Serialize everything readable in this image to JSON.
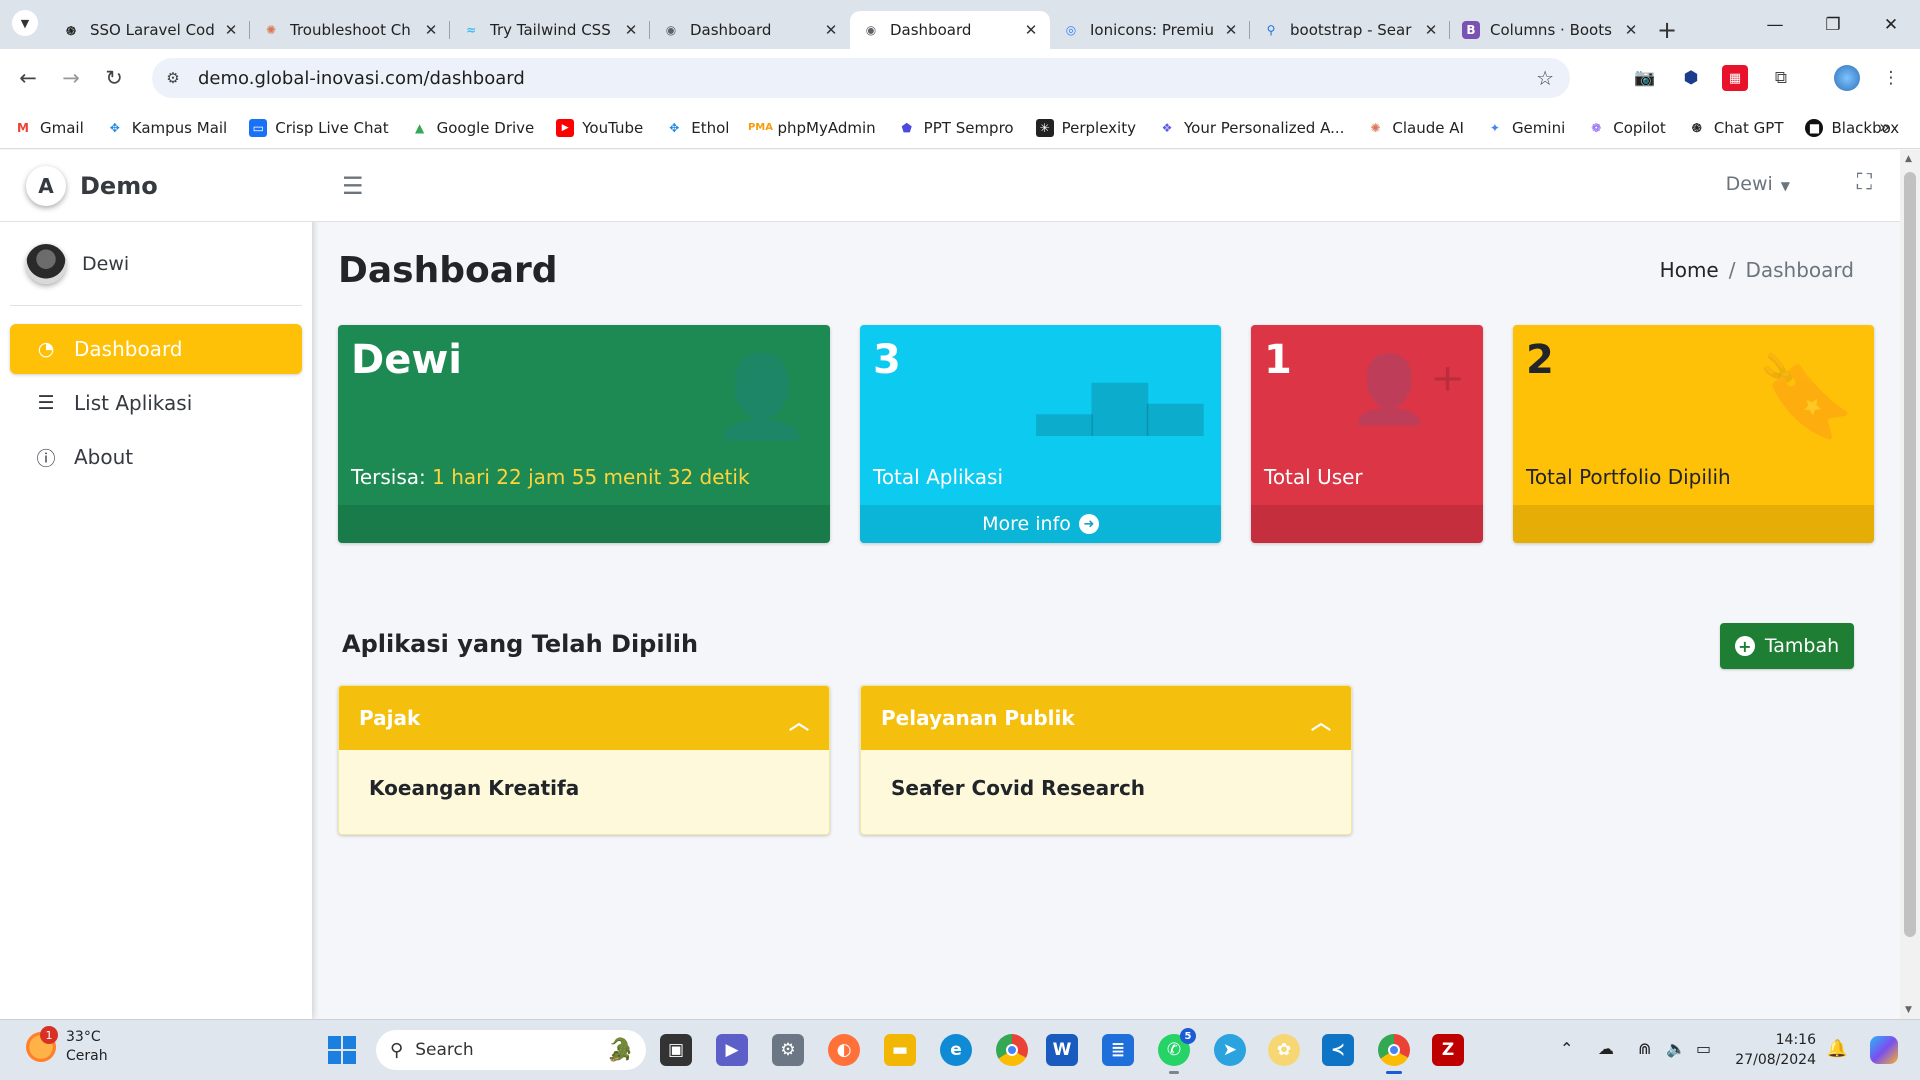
{
  "browser": {
    "tabs": [
      {
        "title": "SSO Laravel Cod",
        "icon": "openai-icon",
        "color": "#222222",
        "active": false
      },
      {
        "title": "Troubleshoot Ch",
        "icon": "claude-icon",
        "color": "#d97757",
        "active": false
      },
      {
        "title": "Try Tailwind CSS",
        "icon": "tailwind-icon",
        "color": "#38bdf8",
        "active": false
      },
      {
        "title": "Dashboard",
        "icon": "globe-icon",
        "color": "#5f6368",
        "active": false
      },
      {
        "title": "Dashboard",
        "icon": "globe-icon",
        "color": "#5f6368",
        "active": true
      },
      {
        "title": "Ionicons: Premiu",
        "icon": "ionicons-icon",
        "color": "#3880ff",
        "active": false
      },
      {
        "title": "bootstrap - Sear",
        "icon": "search-icon",
        "color": "#1a73e8",
        "active": false
      },
      {
        "title": "Columns · Boots",
        "icon": "bootstrap-icon",
        "color": "#7952b3",
        "active": false
      }
    ],
    "url": "demo.global-inovasi.com/dashboard",
    "bookmarks": [
      {
        "label": "Gmail",
        "icon": "gmail-icon",
        "color": "#ea4335"
      },
      {
        "label": "Kampus Mail",
        "icon": "kampus-mail-icon",
        "color": "#1e88e5"
      },
      {
        "label": "Crisp Live Chat",
        "icon": "crisp-icon",
        "color": "#1972f5"
      },
      {
        "label": "Google Drive",
        "icon": "google-drive-icon",
        "color": "#34a853"
      },
      {
        "label": "YouTube",
        "icon": "youtube-icon",
        "color": "#ff0000"
      },
      {
        "label": "Ethol",
        "icon": "ethol-icon",
        "color": "#1e88e5"
      },
      {
        "label": "phpMyAdmin",
        "icon": "phpmyadmin-icon",
        "color": "#f89c0e"
      },
      {
        "label": "PPT Sempro",
        "icon": "ppt-sempro-icon",
        "color": "#4a4adf"
      },
      {
        "label": "Perplexity",
        "icon": "perplexity-icon",
        "color": "#222222"
      },
      {
        "label": "Your Personalized A...",
        "icon": "personalized-icon",
        "color": "#5b5be6"
      },
      {
        "label": "Claude AI",
        "icon": "claude-icon",
        "color": "#d97757"
      },
      {
        "label": "Gemini",
        "icon": "gemini-icon",
        "color": "#4285f4"
      },
      {
        "label": "Copilot",
        "icon": "copilot-icon",
        "color": "#7a4ff0"
      },
      {
        "label": "Chat GPT",
        "icon": "openai-icon",
        "color": "#222222"
      },
      {
        "label": "Blackbox",
        "icon": "blackbox-icon",
        "color": "#111111"
      }
    ]
  },
  "app": {
    "brand": "Demo",
    "brand_logo": "A",
    "user": "Dewi",
    "nav": [
      {
        "label": "Dashboard",
        "icon": "dashboard-icon",
        "active": true
      },
      {
        "label": "List Aplikasi",
        "icon": "list-icon",
        "active": false
      },
      {
        "label": "About",
        "icon": "info-icon",
        "active": false
      }
    ],
    "top_user": "Dewi",
    "page_title": "Dashboard",
    "breadcrumb": {
      "home": "Home",
      "current": "Dashboard"
    },
    "boxes": {
      "user": {
        "name": "Dewi",
        "tersisa_label": "Tersisa:",
        "tersisa_value": "1 hari 22 jam 55 menit 32 detik",
        "color": "#1e8a53"
      },
      "aplikasi": {
        "value": "3",
        "label": "Total Aplikasi",
        "footer": "More info",
        "color": "#0dcaf0"
      },
      "user_count": {
        "value": "1",
        "label": "Total User",
        "color": "#dc3545"
      },
      "portfolio": {
        "value": "2",
        "label": "Total Portfolio Dipilih",
        "color": "#ffc107"
      }
    },
    "section_title": "Aplikasi yang Telah Dipilih",
    "add_button": "Tambah",
    "cards": [
      {
        "header": "Pajak",
        "item": "Koeangan Kreatifa"
      },
      {
        "header": "Pelayanan Publik",
        "item": "Seafer Covid Research"
      }
    ]
  },
  "taskbar": {
    "weather_temp": "33°C",
    "weather_desc": "Cerah",
    "weather_badge": "1",
    "search_placeholder": "Search",
    "whatsapp_badge": "5",
    "time": "14:16",
    "date": "27/08/2024"
  }
}
